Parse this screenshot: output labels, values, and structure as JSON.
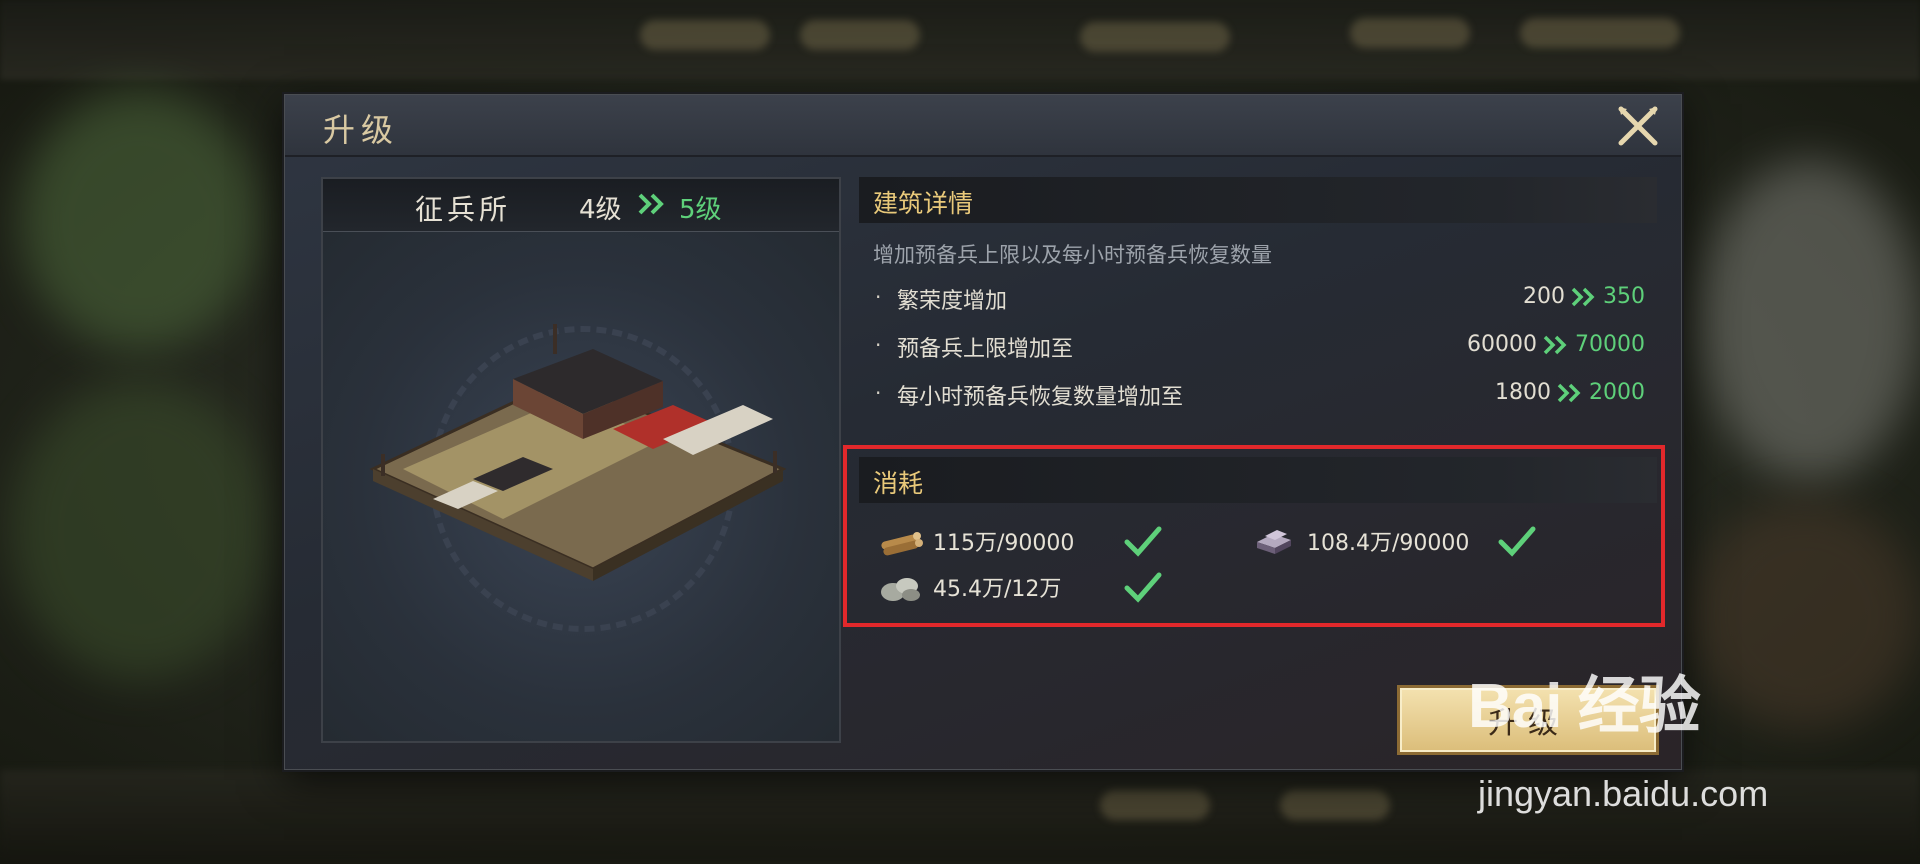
{
  "dialog": {
    "title": "升级",
    "close_icon": "close-crossed-swords-icon"
  },
  "building": {
    "name": "征兵所",
    "level_from": "4级",
    "level_to": "5级"
  },
  "details": {
    "title": "建筑详情",
    "description": "增加预备兵上限以及每小时预备兵恢复数量",
    "stats": [
      {
        "label": "繁荣度增加",
        "from": "200",
        "to": "350"
      },
      {
        "label": "预备兵上限增加至",
        "from": "60000",
        "to": "70000"
      },
      {
        "label": "每小时预备兵恢复数量增加至",
        "from": "1800",
        "to": "2000"
      }
    ]
  },
  "cost": {
    "title": "消耗",
    "items": [
      {
        "icon": "wood-icon",
        "text": "115万/90000",
        "met": true
      },
      {
        "icon": "iron-icon",
        "text": "108.4万/90000",
        "met": true
      },
      {
        "icon": "stone-icon",
        "text": "45.4万/12万",
        "met": true
      }
    ]
  },
  "upgrade_button": {
    "label": "升级"
  },
  "colors": {
    "accent_gold": "#e9c97a",
    "upgrade_green": "#5ed07a",
    "highlight_red": "#e2282b"
  },
  "watermark": {
    "logo": "Bai 经验",
    "url": "jingyan.baidu.com"
  }
}
